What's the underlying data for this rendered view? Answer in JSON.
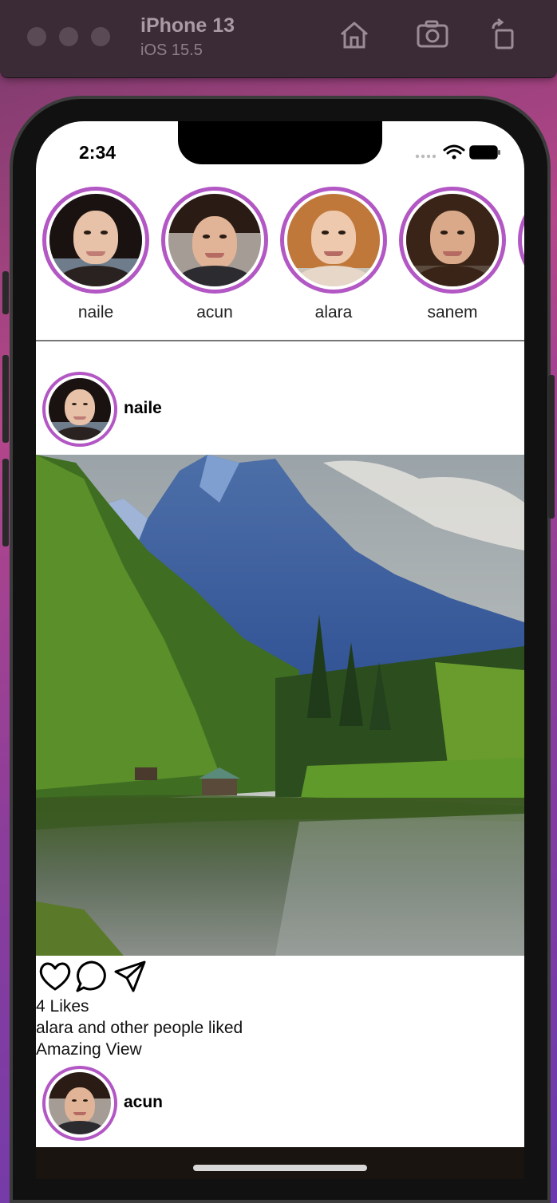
{
  "simulator": {
    "device": "iPhone 13",
    "os": "iOS 15.5",
    "icons": [
      "home-icon",
      "screenshot-icon",
      "rotate-icon"
    ]
  },
  "status_bar": {
    "time": "2:34",
    "icons": [
      "cellular-icon",
      "wifi-icon",
      "battery-icon"
    ]
  },
  "stories": [
    {
      "name": "naile"
    },
    {
      "name": "acun"
    },
    {
      "name": "alara"
    },
    {
      "name": "sanem"
    }
  ],
  "posts": [
    {
      "user": "naile",
      "likes_text": "4 Likes",
      "liked_by_text": "alara and other people liked",
      "caption": "Amazing View"
    },
    {
      "user": "acun"
    }
  ],
  "colors": {
    "story_ring": "#b257c4"
  }
}
